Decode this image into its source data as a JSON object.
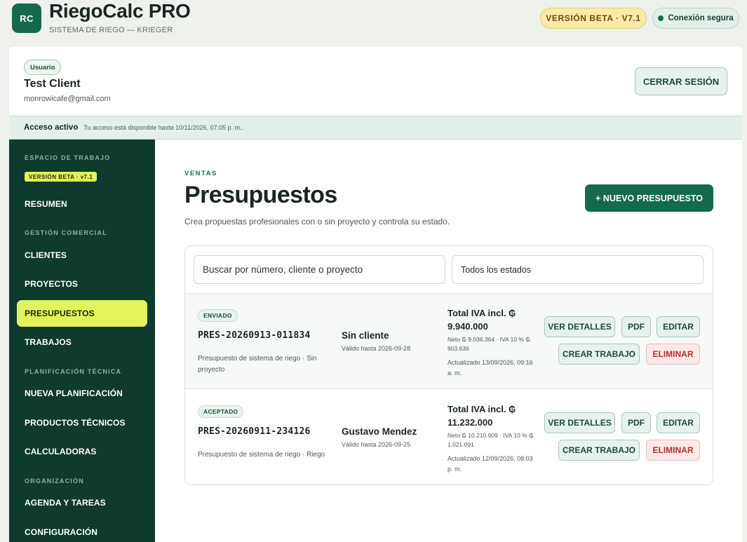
{
  "header": {
    "logo_text": "RC",
    "title": "RiegoCalc PRO",
    "subtitle": "SISTEMA DE RIEGO — KRIEGER",
    "beta_badge": "VERSIÓN BETA · V7.1",
    "secure_label": "Conexión segura"
  },
  "user": {
    "role": "Usuario",
    "name": "Test Client",
    "email": "monrowicafe@gmail.com",
    "logout_label": "CERRAR SESIÓN"
  },
  "access": {
    "title": "Acceso activo",
    "message": "Tu acceso está disponible hasta 10/11/2026, 07:05 p. m.."
  },
  "sidebar": {
    "workspace_label": "ESPACIO DE TRABAJO",
    "beta_badge": "VERSIÓN BETA · v7.1",
    "summary": "RESUMEN",
    "commercial_label": "GESTIÓN COMERCIAL",
    "clients": "CLIENTES",
    "projects": "PROYECTOS",
    "quotes": "PRESUPUESTOS",
    "jobs": "TRABAJOS",
    "technical_label": "PLANIFICACIÓN TÉCNICA",
    "new_planning": "NUEVA PLANIFICACIÓN",
    "technical_products": "PRODUCTOS TÉCNICOS",
    "calculators": "CALCULADORAS",
    "organization_label": "ORGANIZACIÓN",
    "agenda": "AGENDA Y TAREAS",
    "settings": "CONFIGURACIÓN"
  },
  "main": {
    "eyebrow": "VENTAS",
    "title": "Presupuestos",
    "description": "Crea propuestas profesionales con o sin proyecto y controla su estado.",
    "new_button": "+ NUEVO PRESUPUESTO",
    "search_placeholder": "Buscar por número, cliente o proyecto",
    "status_filter": "Todos los estados"
  },
  "actions": {
    "view": "VER DETALLES",
    "pdf": "PDF",
    "edit": "EDITAR",
    "create_job": "CREAR TRABAJO",
    "delete": "ELIMINAR"
  },
  "quotes": [
    {
      "status": "ENVIADO",
      "number": "PRES-20260913-011834",
      "description": "Presupuesto de sistema de riego · Sin proyecto",
      "client": "Sin cliente",
      "valid_until": "Válido hasta 2026-09-28",
      "total": "Total IVA incl. ₲ 9.940.000",
      "breakdown": "Neto ₲ 9.036.364 · IVA 10 % ₲ 903.636",
      "updated": "Actualizado 13/09/2026, 09:16 a. m."
    },
    {
      "status": "ACEPTADO",
      "number": "PRES-20260911-234126",
      "description": "Presupuesto de sistema de riego · Riego",
      "client": "Gustavo Mendez",
      "valid_until": "Válido hasta 2026-09-25",
      "total": "Total IVA incl. ₲ 11.232.000",
      "breakdown": "Neto ₲ 10.210.909 · IVA 10 % ₲ 1.021.091",
      "updated": "Actualizado 12/09/2026, 08:03 p. m."
    }
  ],
  "colors": {
    "brand": "#156a4e",
    "sidebar": "#0f3a2e",
    "active": "#e2f35b",
    "danger": "#b42d2d"
  }
}
